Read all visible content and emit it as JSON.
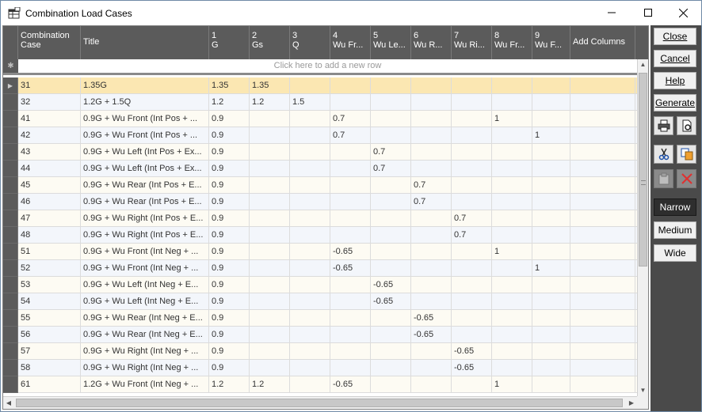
{
  "window": {
    "title": "Combination Load Cases",
    "icon": "grid-window-icon"
  },
  "grid": {
    "columns": [
      {
        "line1": "Combination",
        "line2": "Case"
      },
      {
        "line1": "Title",
        "line2": ""
      },
      {
        "line1": "1",
        "line2": "G"
      },
      {
        "line1": "2",
        "line2": "Gs"
      },
      {
        "line1": "3",
        "line2": "Q"
      },
      {
        "line1": "4",
        "line2": "Wu Fr..."
      },
      {
        "line1": "5",
        "line2": "Wu Le..."
      },
      {
        "line1": "6",
        "line2": "Wu R..."
      },
      {
        "line1": "7",
        "line2": "Wu Ri..."
      },
      {
        "line1": "8",
        "line2": "Wu Fr..."
      },
      {
        "line1": "9",
        "line2": "Wu F..."
      },
      {
        "line1": "Add Columns",
        "line2": ""
      }
    ],
    "new_row_text": "Click here to add a new row",
    "rows": [
      [
        "31",
        "1.35G",
        "1.35",
        "1.35",
        "",
        "",
        "",
        "",
        "",
        "",
        "",
        ""
      ],
      [
        "32",
        "1.2G + 1.5Q",
        "1.2",
        "1.2",
        "1.5",
        "",
        "",
        "",
        "",
        "",
        "",
        ""
      ],
      [
        "41",
        "0.9G + Wu Front (Int Pos + ...",
        "0.9",
        "",
        "",
        "0.7",
        "",
        "",
        "",
        "1",
        "",
        ""
      ],
      [
        "42",
        "0.9G + Wu Front (Int Pos + ...",
        "0.9",
        "",
        "",
        "0.7",
        "",
        "",
        "",
        "",
        "1",
        ""
      ],
      [
        "43",
        "0.9G + Wu Left (Int Pos + Ex...",
        "0.9",
        "",
        "",
        "",
        "0.7",
        "",
        "",
        "",
        "",
        ""
      ],
      [
        "44",
        "0.9G + Wu Left (Int Pos + Ex...",
        "0.9",
        "",
        "",
        "",
        "0.7",
        "",
        "",
        "",
        "",
        ""
      ],
      [
        "45",
        "0.9G + Wu Rear (Int Pos + E...",
        "0.9",
        "",
        "",
        "",
        "",
        "0.7",
        "",
        "",
        "",
        ""
      ],
      [
        "46",
        "0.9G + Wu Rear (Int Pos + E...",
        "0.9",
        "",
        "",
        "",
        "",
        "0.7",
        "",
        "",
        "",
        ""
      ],
      [
        "47",
        "0.9G + Wu Right (Int Pos + E...",
        "0.9",
        "",
        "",
        "",
        "",
        "",
        "0.7",
        "",
        "",
        ""
      ],
      [
        "48",
        "0.9G + Wu Right (Int Pos + E...",
        "0.9",
        "",
        "",
        "",
        "",
        "",
        "0.7",
        "",
        "",
        ""
      ],
      [
        "51",
        "0.9G + Wu Front (Int Neg + ...",
        "0.9",
        "",
        "",
        "-0.65",
        "",
        "",
        "",
        "1",
        "",
        ""
      ],
      [
        "52",
        "0.9G + Wu Front (Int Neg + ...",
        "0.9",
        "",
        "",
        "-0.65",
        "",
        "",
        "",
        "",
        "1",
        ""
      ],
      [
        "53",
        "0.9G + Wu Left (Int Neg + E...",
        "0.9",
        "",
        "",
        "",
        "-0.65",
        "",
        "",
        "",
        "",
        ""
      ],
      [
        "54",
        "0.9G + Wu Left (Int Neg + E...",
        "0.9",
        "",
        "",
        "",
        "-0.65",
        "",
        "",
        "",
        "",
        ""
      ],
      [
        "55",
        "0.9G + Wu Rear (Int Neg + E...",
        "0.9",
        "",
        "",
        "",
        "",
        "-0.65",
        "",
        "",
        "",
        ""
      ],
      [
        "56",
        "0.9G + Wu Rear (Int Neg + E...",
        "0.9",
        "",
        "",
        "",
        "",
        "-0.65",
        "",
        "",
        "",
        ""
      ],
      [
        "57",
        "0.9G + Wu Right (Int Neg + ...",
        "0.9",
        "",
        "",
        "",
        "",
        "",
        "-0.65",
        "",
        "",
        ""
      ],
      [
        "58",
        "0.9G + Wu Right (Int Neg + ...",
        "0.9",
        "",
        "",
        "",
        "",
        "",
        "-0.65",
        "",
        "",
        ""
      ],
      [
        "61",
        "1.2G + Wu Front (Int Neg + ...",
        "1.2",
        "1.2",
        "",
        "-0.65",
        "",
        "",
        "",
        "1",
        "",
        ""
      ]
    ],
    "selected_row": 0
  },
  "panel": {
    "close_label": "Close",
    "cancel_label": "Cancel",
    "help_label": "Help",
    "generate_label": "Generate",
    "narrow_label": "Narrow",
    "medium_label": "Medium",
    "wide_label": "Wide",
    "icons": [
      "print-icon",
      "print-preview-icon",
      "cut-icon",
      "copy-icon",
      "paste-icon",
      "delete-icon"
    ]
  },
  "colors": {
    "header_bg": "#5b5b5b",
    "selected_row": "#fbe7b2",
    "panel_bg": "#4a4a4a",
    "delete_red": "#e03030"
  }
}
